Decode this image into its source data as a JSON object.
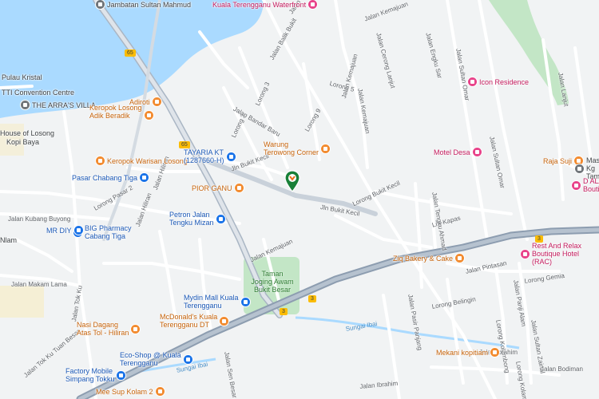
{
  "map": {
    "colors": {
      "water": "#aadaff",
      "land": "#f1f3f4",
      "minor_road": "#ffffff",
      "major_road": "#aab6c4",
      "park": "#c3e6c6",
      "pin": "#188038"
    },
    "markers": {
      "selected_pin": "green-location-pin"
    },
    "area_labels": {
      "roundabout": "Jambatan Sultan Mahmud",
      "rawai": "Pulau Kristal",
      "tti": "TTI Convention Centre",
      "arras": "THE ARRA'S VILLA",
      "house_losong": "House of Losong",
      "kopi_baya": "Kopi Baya",
      "nlam": "Nlam"
    },
    "park_label": "Taman\nJoging Awam\nBukit Besar",
    "water_labels": {
      "sungai_ibai": "Sungai Ibai",
      "sungai_ibai_2": "Sungai Ibai"
    },
    "highway_shields": [
      "65",
      "65",
      "3",
      "3",
      "3"
    ],
    "roads": [
      "Jalan Syed",
      "Jalan Kemajuan",
      "Jalan Balik Bukit",
      "Jalan Cerong Lanjut",
      "Jalan Engku Sar",
      "Lorong 5",
      "Lorong 2",
      "Lorong 3",
      "Lorong 9",
      "Jalan Bandar Baru",
      "Jalan Kemajuan",
      "Jalan Sultan Omar",
      "Jalan Sultan Omar",
      "Jln Bukit Kecil",
      "Jln Bukit Kecil",
      "Lorong Bukit Kecil",
      "Jalan Kubang Buyong",
      "Jalan Hiliran",
      "Jalan Kemajuan",
      "Lrg Kapas",
      "Jalan Tengku Ahmad",
      "Jalan Pintasan",
      "Lorong Gemia",
      "Jalan Makam Lama",
      "Jalan Tok Ku",
      "Jalan Pasir Panjang",
      "Lorong Belingin",
      "Jalan Panji Alam",
      "Lorong Kolambong",
      "Jalan Ibrahim",
      "Jalan Ibrahim",
      "Jalan Bodiman",
      "Jalan Sen Besar",
      "Jalan Tok Ku Tuan Besar",
      "Lorong Pasar 2",
      "Jalan Lanjut",
      "Jalan Hiliran",
      "Jalan Kemajuan",
      "Lorong Kolambong",
      "Jalan Sultan Zainal"
    ],
    "pois": [
      {
        "label": "Kuala Terengganu Waterfront",
        "kind": "hotel"
      },
      {
        "label": "Adiroti",
        "kind": "food"
      },
      {
        "label": "Keropok Losong\nAdik Beradik",
        "kind": "food"
      },
      {
        "label": "Keropok Warisan Losong",
        "kind": "food"
      },
      {
        "label": "Pasar Chabang Tiga",
        "kind": "shop"
      },
      {
        "label": "TAYARIA KT\n(1287660-H)",
        "kind": "shop"
      },
      {
        "label": "PIOR GANU",
        "kind": "food"
      },
      {
        "label": "Warung\nTerowong Corner",
        "kind": "food"
      },
      {
        "label": "Icon Residence",
        "kind": "hotel"
      },
      {
        "label": "Motel Desa",
        "kind": "hotel"
      },
      {
        "label": "Raja Suji",
        "kind": "food"
      },
      {
        "label": "Masjid Kg\nTaman",
        "kind": "gray"
      },
      {
        "label": "D ALA\nBoutique",
        "kind": "hotel"
      },
      {
        "label": "Petron Jalan\nTengku Mizan",
        "kind": "shop"
      },
      {
        "label": "BIG Pharmacy\nCabang Tiga",
        "kind": "shop"
      },
      {
        "label": "MR DIY",
        "kind": "shop"
      },
      {
        "label": "Ziq Bakery & Cake",
        "kind": "food"
      },
      {
        "label": "Rest And Relax\nBoutique Hotel (RAC)",
        "kind": "hotel"
      },
      {
        "label": "Mydin Mall Kuala\nTerengganu",
        "kind": "shop"
      },
      {
        "label": "McDonald's Kuala\nTerengganu DT",
        "kind": "food"
      },
      {
        "label": "Nasi Dagang\nAtas Tol - Hiliran",
        "kind": "food"
      },
      {
        "label": "Eco-Shop @ Kuala\nTerengganu",
        "kind": "shop"
      },
      {
        "label": "Factory Mobile\nSimpang Tokku",
        "kind": "shop"
      },
      {
        "label": "Mee Sup Kolam 2",
        "kind": "food"
      },
      {
        "label": "Mekani kopitiam",
        "kind": "food"
      }
    ]
  }
}
